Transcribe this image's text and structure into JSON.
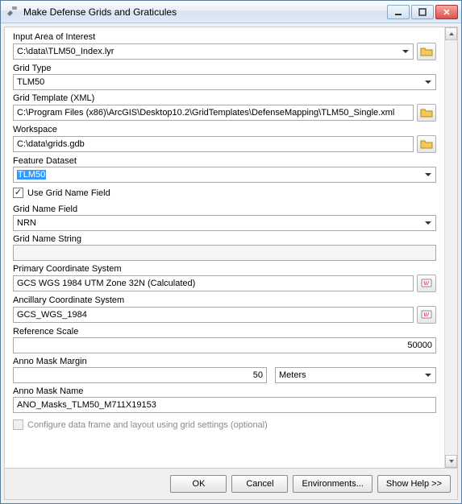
{
  "window": {
    "title": "Make Defense Grids and Graticules"
  },
  "labels": {
    "input_area": "Input Area of Interest",
    "grid_type": "Grid Type",
    "grid_template": "Grid Template (XML)",
    "workspace": "Workspace",
    "feature_dataset": "Feature Dataset",
    "use_grid_name": "Use Grid Name Field",
    "grid_name_field": "Grid Name Field",
    "grid_name_string": "Grid Name String",
    "primary_cs": "Primary Coordinate System",
    "ancillary_cs": "Ancillary Coordinate System",
    "reference_scale": "Reference Scale",
    "anno_mask_margin": "Anno Mask Margin",
    "anno_mask_name": "Anno Mask Name",
    "configure_df": "Configure data frame and layout using grid settings (optional)"
  },
  "values": {
    "input_area": "C:\\data\\TLM50_Index.lyr",
    "grid_type": "TLM50",
    "grid_template": "C:\\Program Files (x86)\\ArcGIS\\Desktop10.2\\GridTemplates\\DefenseMapping\\TLM50_Single.xml",
    "workspace": "C:\\data\\grids.gdb",
    "feature_dataset": "TLM50",
    "grid_name_field": "NRN",
    "grid_name_string": "",
    "primary_cs": "GCS WGS 1984 UTM Zone 32N (Calculated)",
    "ancillary_cs": "GCS_WGS_1984",
    "reference_scale": "50000",
    "anno_mask_margin": "50",
    "anno_mask_margin_unit": "Meters",
    "anno_mask_name": "ANO_Masks_TLM50_M711X19153"
  },
  "checks": {
    "use_grid_name": true,
    "configure_df": false
  },
  "buttons": {
    "ok": "OK",
    "cancel": "Cancel",
    "environments": "Environments...",
    "showhelp": "Show Help >>"
  }
}
